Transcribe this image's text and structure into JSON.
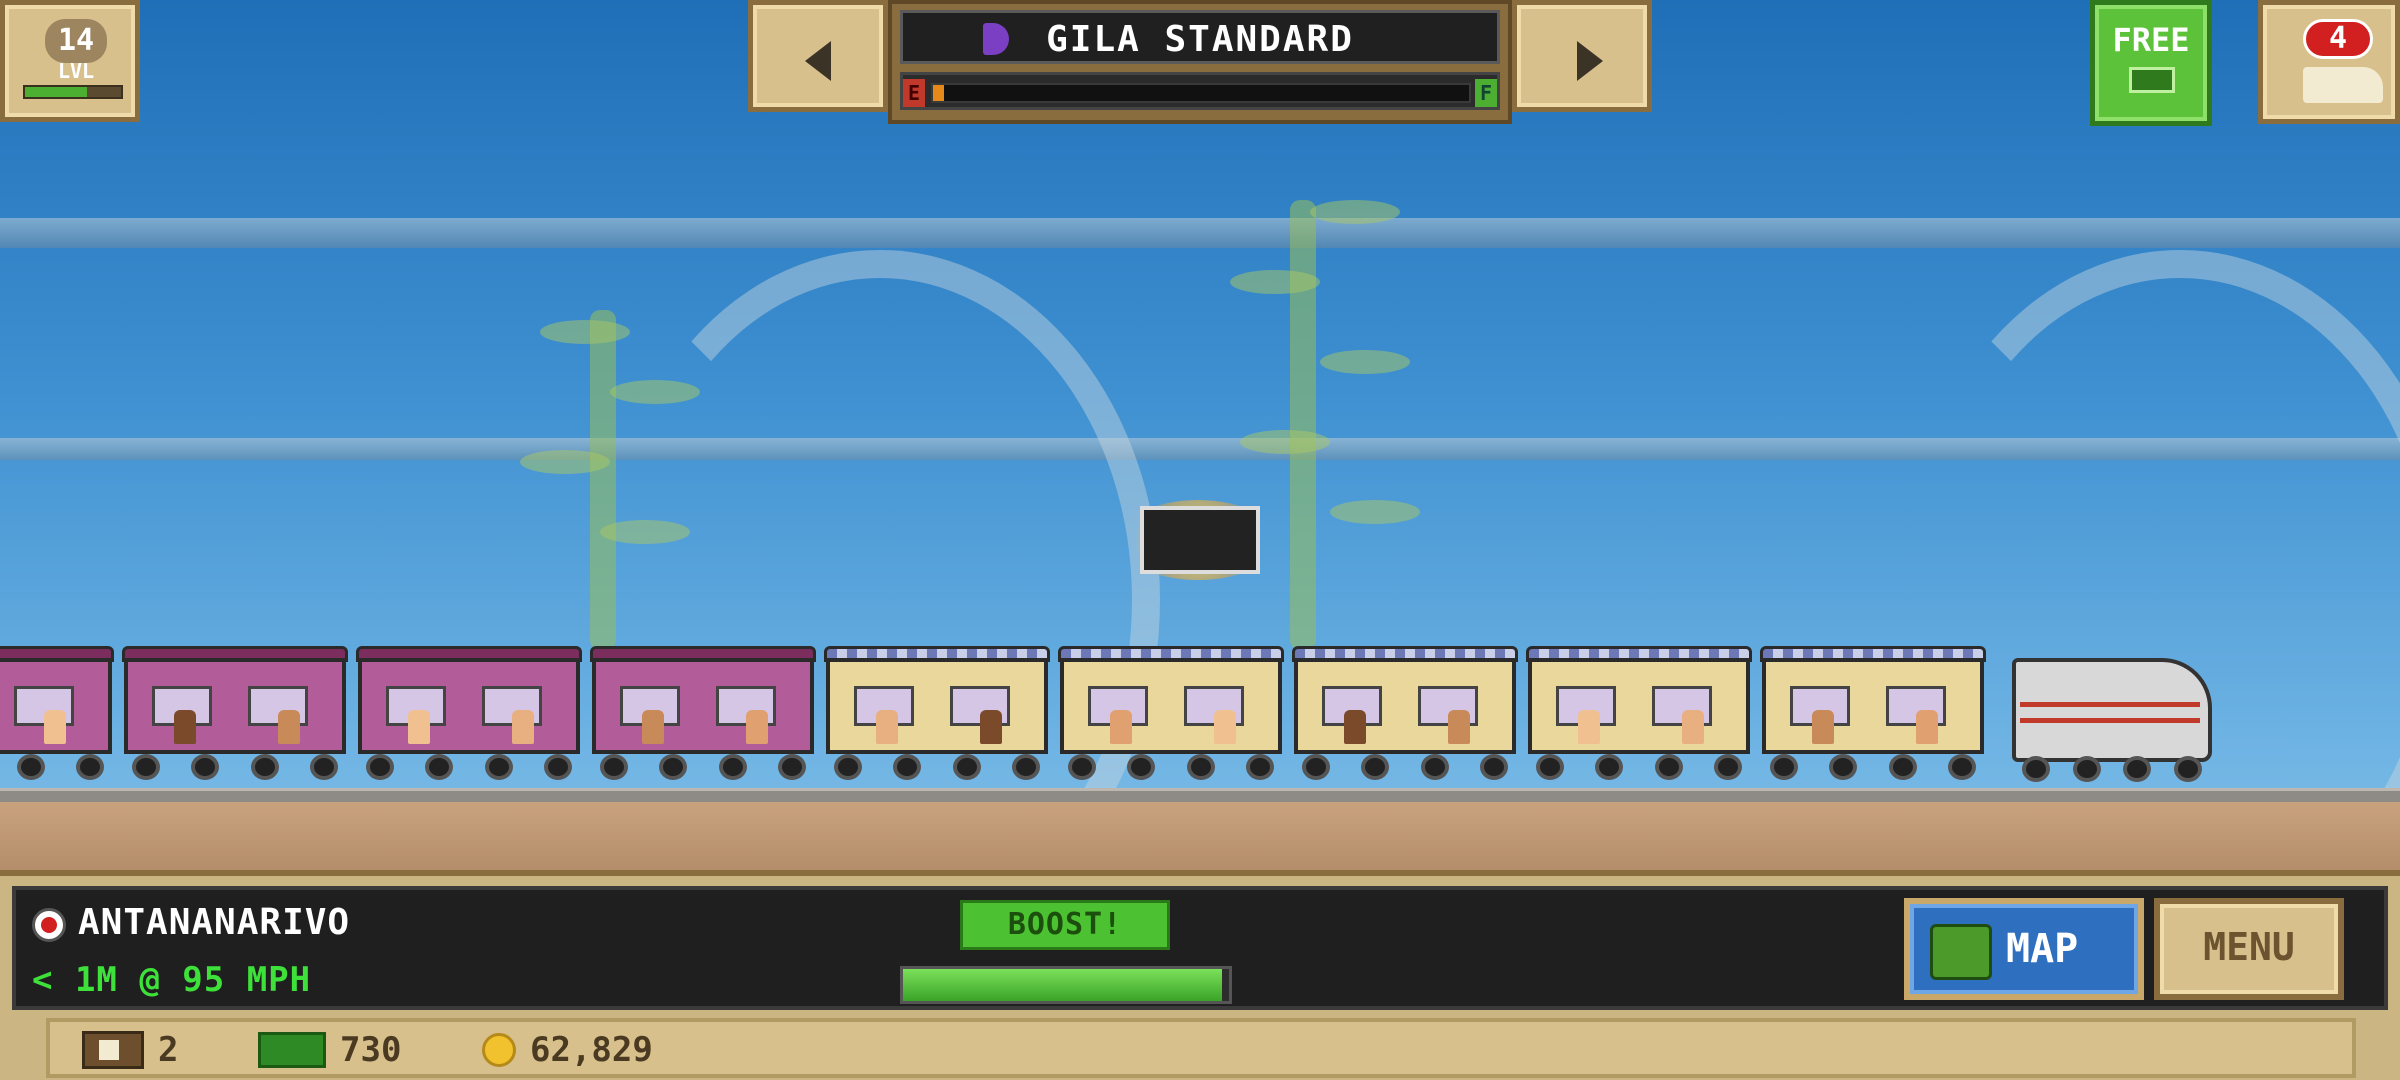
{
  "top_hud": {
    "level": {
      "number": "14",
      "label": "LVL",
      "progress": 0.65
    },
    "train_selector": {
      "train_name": "GILA STANDARD",
      "fuel_empty_label": "E",
      "fuel_full_label": "F",
      "fuel_level": 0.01
    },
    "free_button": {
      "label": "FREE"
    },
    "trains_button": {
      "badge_count": "4"
    }
  },
  "train": {
    "cars": [
      {
        "type": "lounge"
      },
      {
        "type": "lounge"
      },
      {
        "type": "lounge"
      },
      {
        "type": "lounge"
      },
      {
        "type": "dining"
      },
      {
        "type": "dining"
      },
      {
        "type": "dining"
      },
      {
        "type": "dining"
      },
      {
        "type": "dining"
      }
    ],
    "engine": {
      "type": "diesel"
    }
  },
  "bottom_hud": {
    "station_name": "ANTANANARIVO",
    "speed_text": "< 1M @ 95 MPH",
    "boost_label": "BOOST!",
    "boost_level": 0.98,
    "map_label": "MAP",
    "menu_label": "MENU"
  },
  "inventory": {
    "crates": "2",
    "cash": "730",
    "coins": "62,829"
  },
  "colors": {
    "accent_green": "#4cc232",
    "map_blue": "#2f6fc0",
    "panel_tan": "#d8c08c",
    "station_red": "#d21f1f"
  }
}
